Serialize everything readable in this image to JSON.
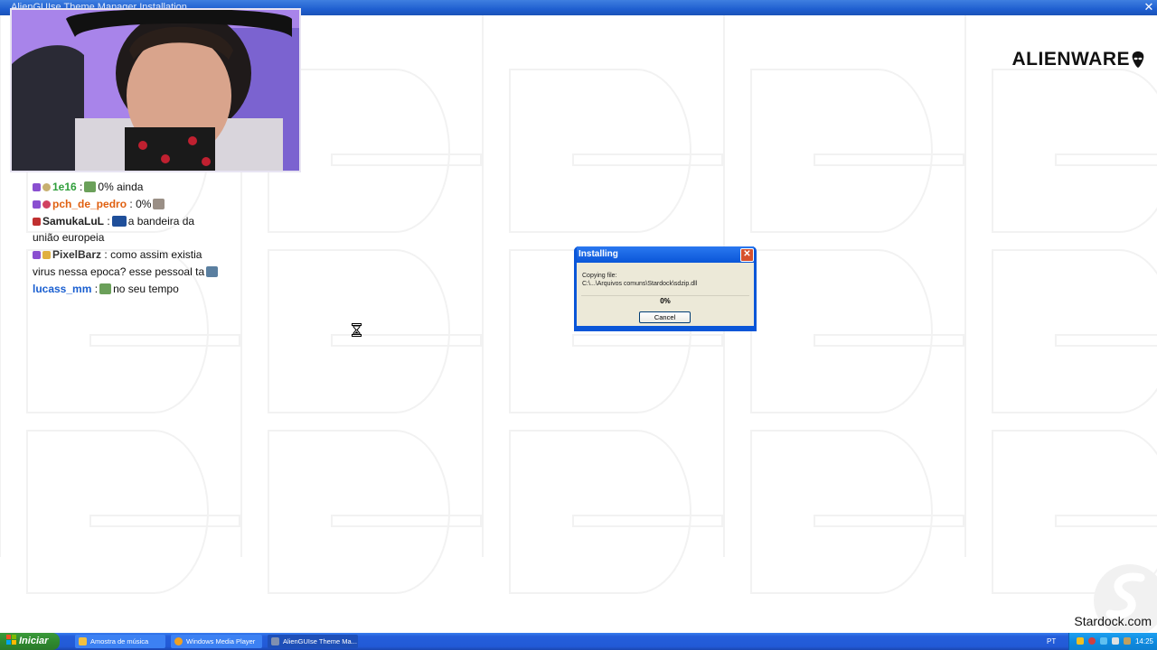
{
  "window": {
    "title": "AlienGUIse Theme Manager Installation"
  },
  "logo": {
    "text": "ALIENWARE"
  },
  "chat": [
    {
      "user": "1e16",
      "sep": ":",
      "message": "0% ainda",
      "user_color": "#2f9e3a",
      "badge_color": "#8a4fd0",
      "emote_color": "#6ba05a"
    },
    {
      "user": "pch_de_pedro",
      "sep": ":",
      "message": "0%",
      "user_color": "#e06010",
      "badge_color": "#c0405a",
      "emote_color": "#9a8f86"
    },
    {
      "user": "SamukaLuL",
      "sep": ":",
      "message": "a bandeira da",
      "message2": "união europeia",
      "user_color": "#222222",
      "badge_color": "#c03030",
      "emote_color": "#1f4f9a"
    },
    {
      "user": "PixelBarz",
      "sep": ":",
      "message": "como assim existia",
      "message2": "virus nessa epoca? esse pessoal ta",
      "user_color": "#333333",
      "badge_color": "#8a4fd0",
      "emote_color": "#5a7fa0"
    },
    {
      "user": "lucass_mm",
      "sep": ":",
      "message": "no seu tempo",
      "user_color": "#1a5fd0",
      "badge_color": "",
      "emote_color": "#6ba05a"
    }
  ],
  "dialog": {
    "title": "Installing",
    "label": "Copying file:",
    "path": "C:\\...\\Arquivos comuns\\Stardock\\sdzip.dll",
    "percent": "0%",
    "progress": 0,
    "cancel": "Cancel"
  },
  "watermark": {
    "text": "Stardock.com"
  },
  "taskbar": {
    "start": "Iniciar",
    "tasks": [
      {
        "label": "Amostra de música",
        "icon_color": "#f2c040"
      },
      {
        "label": "Windows Media Player",
        "icon_color": "#f0a020"
      },
      {
        "label": "AlienGUIse Theme Ma...",
        "icon_color": "#8090b0"
      }
    ],
    "language": "PT",
    "clock": "14:25"
  }
}
